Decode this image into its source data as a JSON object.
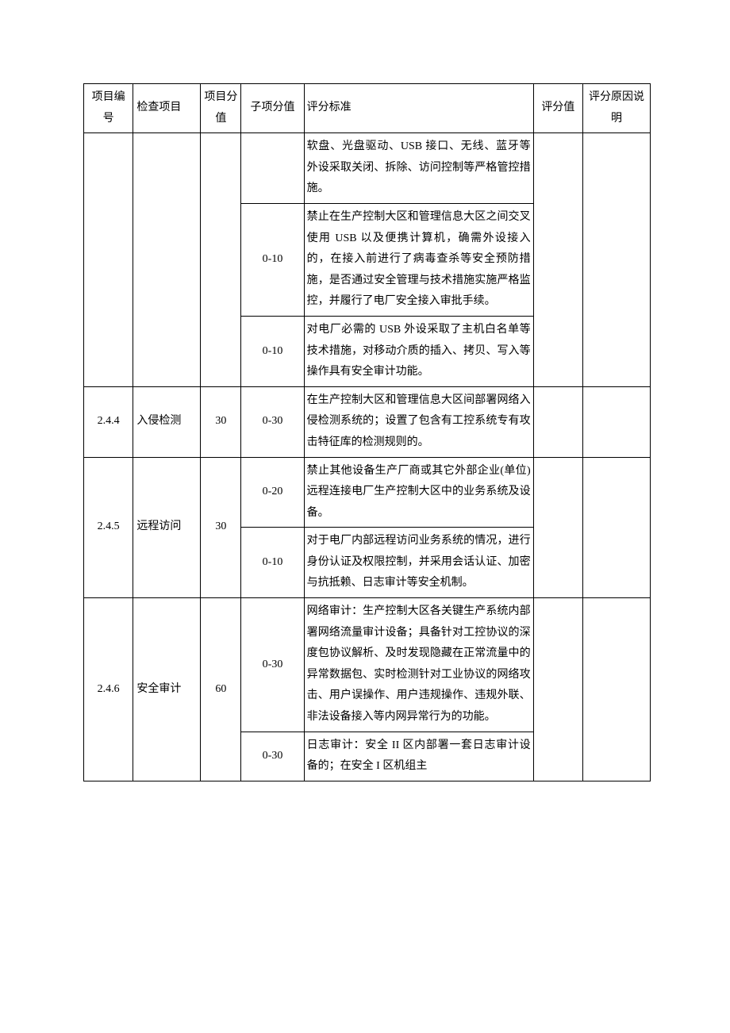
{
  "headers": {
    "id": "项目编号",
    "item": "检查项目",
    "score": "项目分值",
    "sub": "子项分值",
    "std": "评分标准",
    "val": "评分值",
    "rsn": "评分原因说明"
  },
  "rows": [
    {
      "id": "",
      "item": "",
      "score": "",
      "sub": "",
      "std": "软盘、光盘驱动、USB 接口、无线、蓝牙等外设采取关闭、拆除、访问控制等严格管控措施。",
      "val": "",
      "rsn": "",
      "span_id": 3,
      "span_item": 3,
      "span_score": 3,
      "span_val": 3,
      "span_rsn": 3
    },
    {
      "id": null,
      "item": null,
      "score": null,
      "sub": "0-10",
      "std": "禁止在生产控制大区和管理信息大区之间交叉使用 USB 以及便携计算机，确需外设接入的，在接入前进行了病毒查杀等安全预防措施，是否通过安全管理与技术措施实施严格监控，并履行了电厂安全接入审批手续。",
      "val": null,
      "rsn": null
    },
    {
      "id": null,
      "item": null,
      "score": null,
      "sub": "0-10",
      "std": "对电厂必需的 USB 外设采取了主机白名单等技术措施，对移动介质的插入、拷贝、写入等操作具有安全审计功能。",
      "val": null,
      "rsn": null
    },
    {
      "id": "2.4.4",
      "item": "入侵检测",
      "score": "30",
      "sub": "0-30",
      "std": "在生产控制大区和管理信息大区间部署网络入侵检测系统的；设置了包含有工控系统专有攻击特征库的检测规则的。",
      "val": "",
      "rsn": ""
    },
    {
      "id": "2.4.5",
      "item": "远程访问",
      "score": "30",
      "sub": "0-20",
      "std": "禁止其他设备生产厂商或其它外部企业(单位)远程连接电厂生产控制大区中的业务系统及设备。",
      "val": "",
      "rsn": "",
      "span_id": 2,
      "span_item": 2,
      "span_score": 2,
      "span_val": 2,
      "span_rsn": 2
    },
    {
      "id": null,
      "item": null,
      "score": null,
      "sub": "0-10",
      "std": "对于电厂内部远程访问业务系统的情况，进行身份认证及权限控制，并采用会话认证、加密与抗抵赖、日志审计等安全机制。",
      "val": null,
      "rsn": null
    },
    {
      "id": "2.4.6",
      "item": "安全审计",
      "score": "60",
      "sub": "0-30",
      "std": "网络审计：生产控制大区各关键生产系统内部署网络流量审计设备；具备针对工控协议的深度包协议解析、及时发现隐藏在正常流量中的异常数据包、实时检测针对工业协议的网络攻击、用户误操作、用户违规操作、违规外联、非法设备接入等内网异常行为的功能。",
      "val": "",
      "rsn": "",
      "span_id": 2,
      "span_item": 2,
      "span_score": 2,
      "span_val": 2,
      "span_rsn": 2
    },
    {
      "id": null,
      "item": null,
      "score": null,
      "sub": "0-30",
      "std": "日志审计：安全 II 区内部署一套日志审计设备的；在安全 I 区机组主",
      "val": null,
      "rsn": null
    }
  ]
}
